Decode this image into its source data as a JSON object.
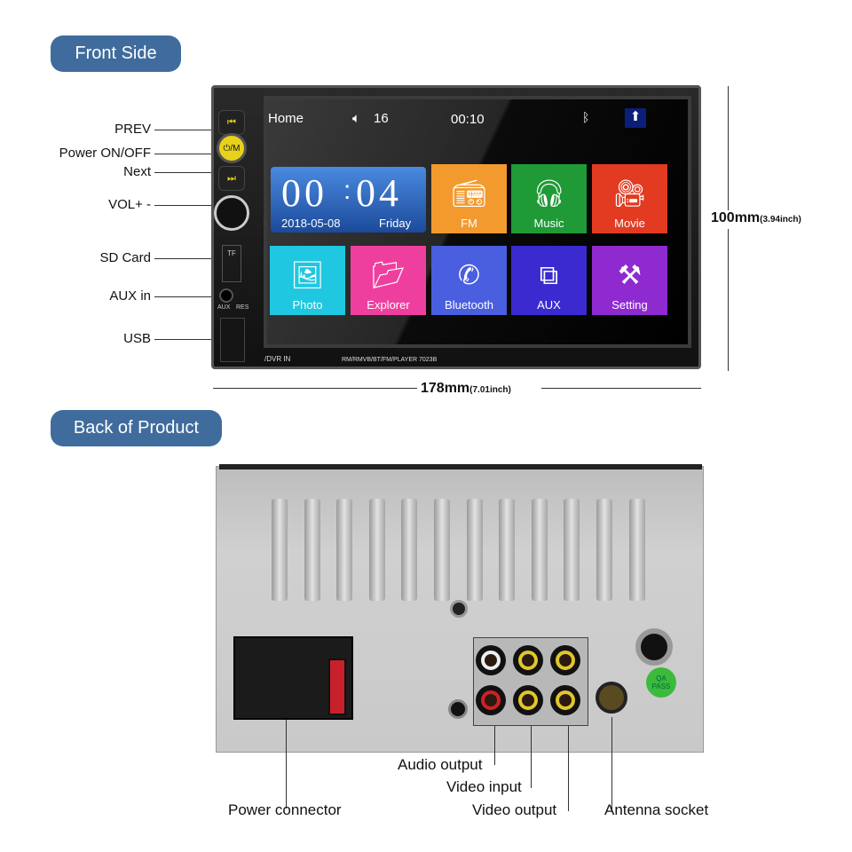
{
  "front_section": {
    "title": "Front Side"
  },
  "back_section": {
    "title": "Back of Product"
  },
  "front_labels": [
    "PREV",
    "Power ON/OFF",
    "Next",
    "VOL+ -",
    "SD Card",
    "AUX in",
    "USB"
  ],
  "dimensions": {
    "height_main": "100mm",
    "height_sub": "(3.94inch)",
    "width_main": "178mm",
    "width_sub": "(7.01inch)"
  },
  "screen": {
    "status": {
      "home": "Home",
      "volume": "16",
      "time": "00:10"
    },
    "clock": {
      "hours": "00",
      "minutes": "04",
      "date": "2018-05-08",
      "day": "Friday"
    },
    "tiles": [
      {
        "label": "FM",
        "icon": "radio-icon",
        "color": "#f39a2e"
      },
      {
        "label": "Music",
        "icon": "headphones-icon",
        "color": "#1f9a36"
      },
      {
        "label": "Movie",
        "icon": "movie-camera-icon",
        "color": "#e23b22"
      },
      {
        "label": "Photo",
        "icon": "photo-icon",
        "color": "#1fc8e0"
      },
      {
        "label": "Explorer",
        "icon": "folder-icon",
        "color": "#ef3f9e"
      },
      {
        "label": "Bluetooth",
        "icon": "phone-bluetooth-icon",
        "color": "#4a5ee0"
      },
      {
        "label": "AUX",
        "icon": "aux-monitor-icon",
        "color": "#3a2ad0"
      },
      {
        "label": "Setting",
        "icon": "tools-icon",
        "color": "#8e2ad0"
      }
    ],
    "bezel_text": {
      "dvr": "/DVR IN",
      "model": "RM/RMVB/BT/FM/PLAYER 7023B"
    },
    "panel_text": {
      "tf": "TF",
      "aux": "AUX",
      "res": "RES",
      "power": "⏻/M"
    }
  },
  "back_labels": {
    "audio_output": "Audio output",
    "video_input": "Video input",
    "video_output": "Video output",
    "antenna": "Antenna socket",
    "power": "Power connector",
    "qa": "QA PASS"
  }
}
